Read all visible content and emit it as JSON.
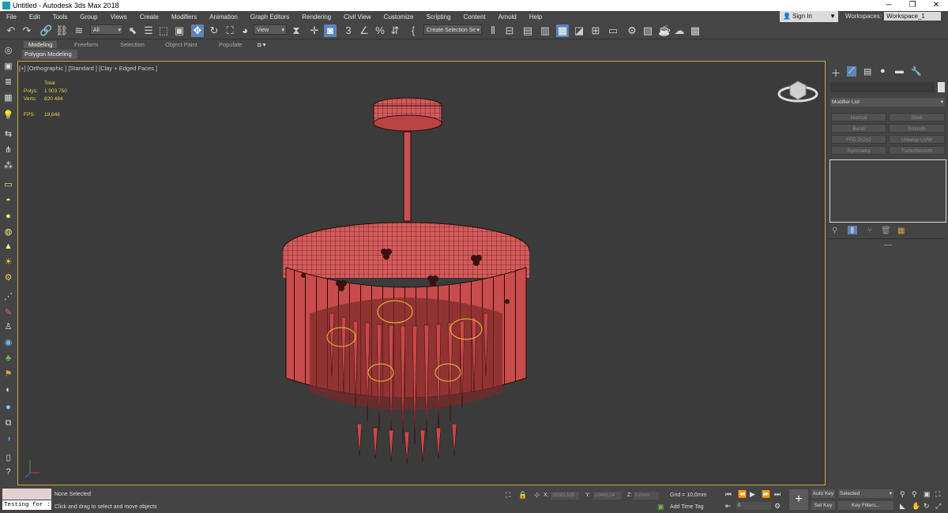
{
  "window": {
    "title": "Untitled - Autodesk 3ds Max 2018",
    "controls": [
      "─",
      "❐",
      "✕"
    ]
  },
  "menu": [
    "File",
    "Edit",
    "Tools",
    "Group",
    "Views",
    "Create",
    "Modifiers",
    "Animation",
    "Graph Editors",
    "Rendering",
    "Civil View",
    "Customize",
    "Scripting",
    "Content",
    "Arnold",
    "Help"
  ],
  "account": {
    "sign_in": "Sign In",
    "workspaces_label": "Workspaces:",
    "workspace": "Workspace_1"
  },
  "toolbar": {
    "filter": "All",
    "ref_coord": "View",
    "selection_set": "Create Selection Se",
    "snap_angle": "3",
    "percent": "%"
  },
  "ribbon": {
    "tabs": [
      "Modeling",
      "Freeform",
      "Selection",
      "Object Paint",
      "Populate"
    ],
    "sub": "Polygon Modeling"
  },
  "viewport": {
    "label": "[+] [Orthographic ] [Standard ] [Clay + Edged Faces ]",
    "stats": {
      "total": "Total",
      "polys_label": "Polys:",
      "polys": "1 003 750",
      "verts_label": "Verts:",
      "verts": "820 484",
      "fps_label": "FPS:",
      "fps": "19,646"
    },
    "mesh_color": "#d55a5a",
    "wire_color": "#2a0a0a",
    "frame_color": "#c9a640"
  },
  "command_panel": {
    "modifier_list": "Modifier List",
    "buttons": [
      "Normal",
      "Shell",
      "Bend",
      "Smooth",
      "FFD 2x2x2",
      "Unwrap UVW",
      "Symmetry",
      "TurboSmooth"
    ]
  },
  "status": {
    "maxscript": "Testing for :",
    "selection": "None Selected",
    "prompt": "Click and drag to select and move objects",
    "x_label": "X:",
    "x": "39381,535",
    "y_label": "Y:",
    "y": "10466,34",
    "z_label": "Z:",
    "z": "0,0mm",
    "grid": "Grid = 10,0mm",
    "add_time_tag": "Add Time Tag",
    "auto_key": "Auto Key",
    "set_key": "Set Key",
    "key_mode": "Selected",
    "key_filters": "Key Filters...",
    "frame": "0"
  }
}
